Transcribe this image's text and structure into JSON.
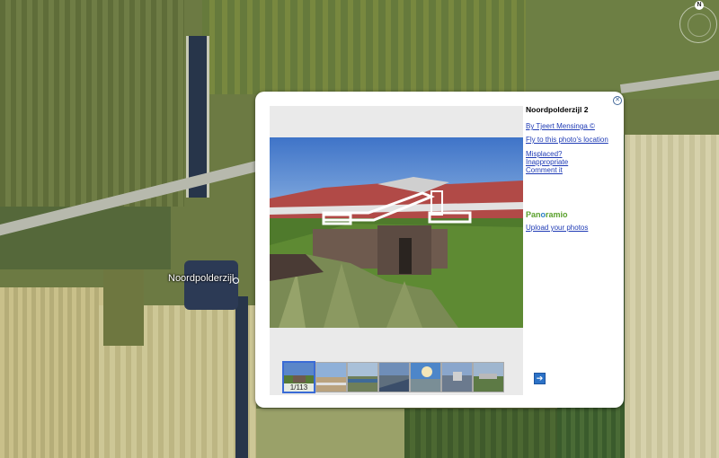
{
  "map": {
    "place_label": "Noordpolderzijl",
    "compass_label": "N"
  },
  "balloon": {
    "title": "Noordpolderzijl 2",
    "author_link": "By Tjeert Mensinga ©",
    "fly_link": "Fly to this photo's location",
    "actions": [
      "Misplaced?",
      "Inappropriate",
      "Comment it"
    ],
    "brand_text_1": "Pan",
    "brand_text_2": "o",
    "brand_text_3": "ramio",
    "upload_link": "Upload your photos",
    "thumb_counter": "1/113",
    "close_icon": "close-icon",
    "next_icon": "arrow-right-icon"
  },
  "colors": {
    "link": "#1f3bb5",
    "brand_green": "#5aa02c",
    "brand_blue": "#2d80c6",
    "selected_thumb": "#3a6bd6"
  }
}
